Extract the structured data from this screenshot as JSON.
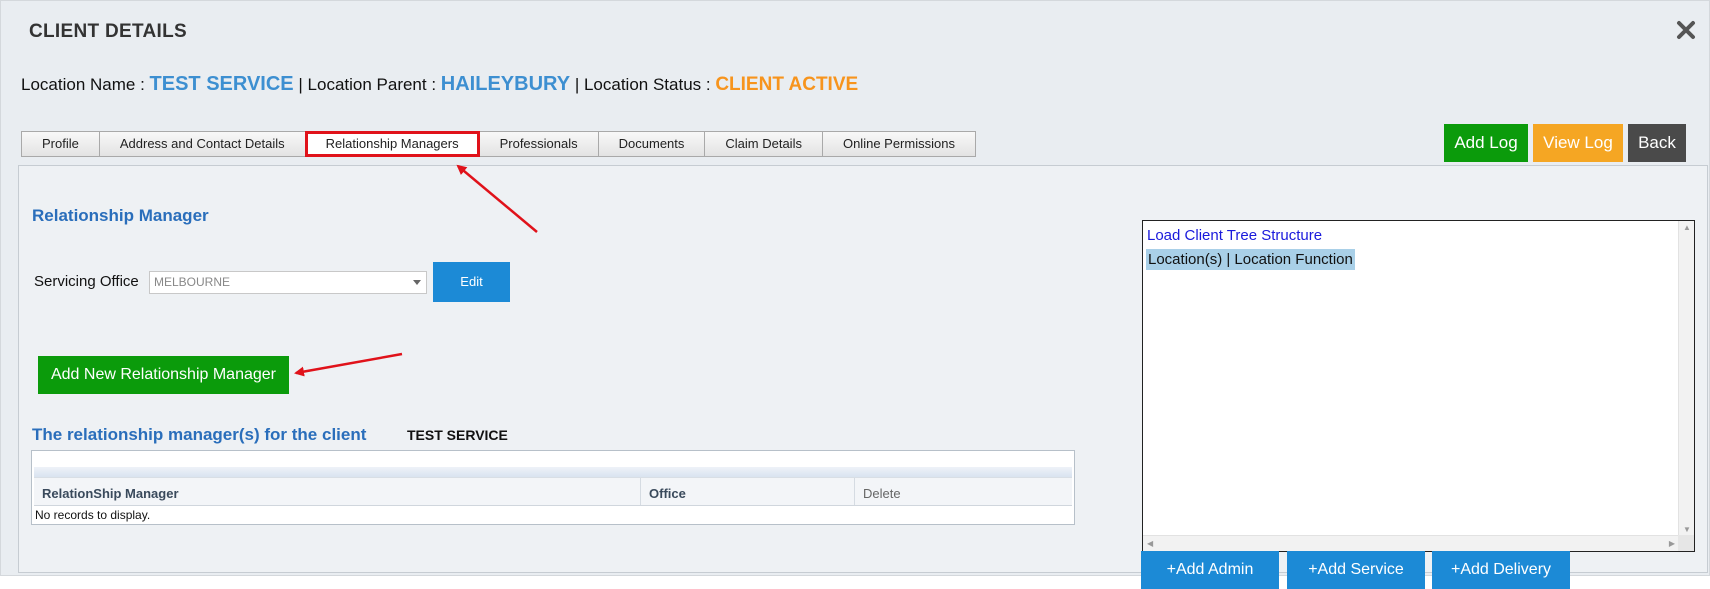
{
  "dialog": {
    "title": "CLIENT DETAILS",
    "close_icon": "close-icon"
  },
  "location": {
    "name_label": "Location Name :",
    "name_value": "TEST SERVICE",
    "parent_label": "| Location Parent :",
    "parent_value": "HAILEYBURY",
    "status_label": "| Location Status :",
    "status_value": "CLIENT ACTIVE"
  },
  "tabs": [
    {
      "label": "Profile"
    },
    {
      "label": "Address and Contact Details"
    },
    {
      "label": "Relationship Managers",
      "active": true
    },
    {
      "label": "Professionals"
    },
    {
      "label": "Documents"
    },
    {
      "label": "Claim Details"
    },
    {
      "label": "Online Permissions"
    }
  ],
  "top_buttons": {
    "add_log": "Add Log",
    "view_log": "View Log",
    "back": "Back"
  },
  "relationship": {
    "heading": "Relationship Manager",
    "servicing_office_label": "Servicing Office",
    "servicing_office_value": "MELBOURNE",
    "edit_label": "Edit",
    "add_new_label": "Add New Relationship Manager",
    "list_heading": "The relationship manager(s) for the client",
    "client_name": "TEST SERVICE"
  },
  "grid": {
    "columns": [
      "RelationShip Manager",
      "Office",
      "Delete"
    ],
    "empty_text": "No records to display."
  },
  "tree": {
    "load_link": "Load Client Tree Structure",
    "node_label": "Location(s) | Location Function"
  },
  "bottom_buttons": {
    "add_admin": "+Add Admin",
    "add_service": "+Add Service",
    "add_delivery": "+Add Delivery"
  },
  "colors": {
    "accent_blue": "#3d8fd1",
    "status_orange": "#f7941d",
    "green_button": "#0b9b0b",
    "orange_button": "#f5a623",
    "dark_button": "#4a4a4a",
    "blue_button": "#1c8ad6",
    "annotation_red": "#e0121a"
  }
}
